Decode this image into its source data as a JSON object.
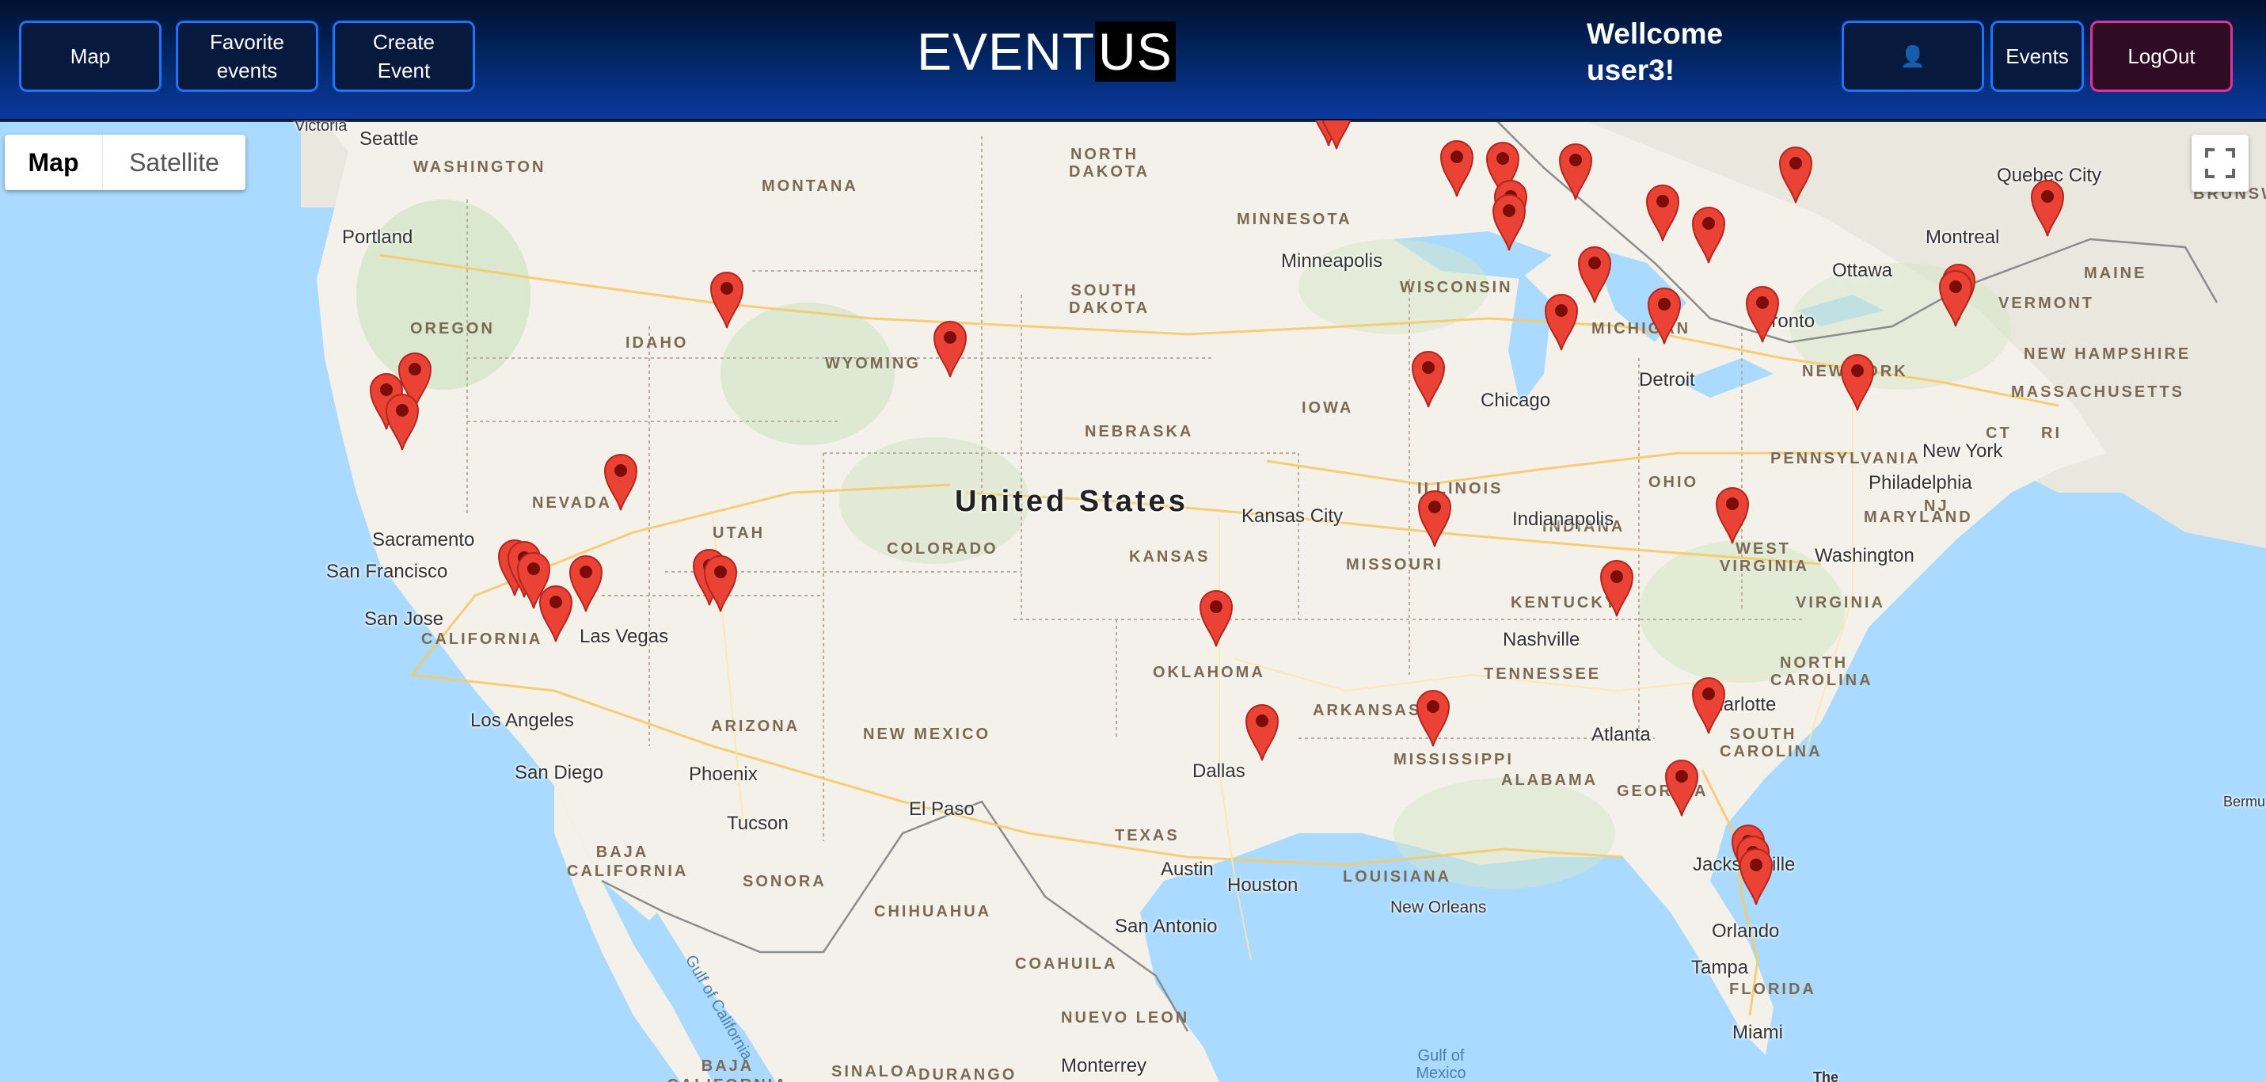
{
  "nav": {
    "map_label": "Map",
    "favorite_label": "Favorite events",
    "create_label": "Create Event",
    "brand_left": "EVENT",
    "brand_right": "US",
    "welcome": "Wellcome user3!",
    "user_icon": "👤",
    "events_label": "Events",
    "logout_label": "LogOut"
  },
  "map": {
    "map_type_map": "Map",
    "map_type_satellite": "Satellite",
    "fullscreen_icon": "fullscreen-icon",
    "country_label": "United States",
    "states": [
      "WASHINGTON",
      "MONTANA",
      "NORTH DAKOTA",
      "MINNESOTA",
      "OREGON",
      "IDAHO",
      "SOUTH DAKOTA",
      "WYOMING",
      "WISCONSIN",
      "MICHIGAN",
      "NEBRASKA",
      "IOWA",
      "NEVADA",
      "UTAH",
      "ILLINOIS",
      "INDIANA",
      "OHIO",
      "PENNSYLVANIA",
      "NEW YORK",
      "VERMONT",
      "MAINE",
      "NEW HAMPSHIRE",
      "MASSACHUSETTS",
      "COLORADO",
      "KANSAS",
      "MISSOURI",
      "CALIFORNIA",
      "WEST VIRGINIA",
      "VIRGINIA",
      "KENTUCKY",
      "MARYLAND",
      "NJ",
      "CT",
      "RI",
      "OKLAHOMA",
      "ARKANSAS",
      "TENNESSEE",
      "NORTH CAROLINA",
      "SOUTH CAROLINA",
      "ARIZONA",
      "NEW MEXICO",
      "MISSISSIPPI",
      "ALABAMA",
      "GEORGIA",
      "TEXAS",
      "LOUISIANA",
      "FLORIDA",
      "BAJA CALIFORNIA",
      "SONORA",
      "CHIHUAHUA",
      "COAHUILA",
      "NUEVO LEON",
      "DURANGO",
      "SINALOA",
      "BAJA CALIFORNIA SUR",
      "BRUNSWICK"
    ],
    "cities": [
      "Victoria",
      "Seattle",
      "Portland",
      "Quebec City",
      "Montreal",
      "Ottawa",
      "Toronto",
      "Minneapolis",
      "Detroit",
      "Chicago",
      "Sacramento",
      "San Francisco",
      "San Jose",
      "Las Vegas",
      "Los Angeles",
      "San Diego",
      "Phoenix",
      "Tucson",
      "El Paso",
      "Kansas City",
      "Indianapolis",
      "Washington",
      "Philadelphia",
      "New York",
      "Nashville",
      "Charlotte",
      "Atlanta",
      "Dallas",
      "Austin",
      "Houston",
      "San Antonio",
      "New Orleans",
      "Jacksonville",
      "Orlando",
      "Tampa",
      "Miami",
      "Monterrey",
      "Bermuda",
      "The"
    ],
    "water_labels": [
      "Gulf of California",
      "Gulf of Mexico"
    ],
    "marker_icon": "map-pin-icon",
    "marker_color": "#ea4335"
  }
}
